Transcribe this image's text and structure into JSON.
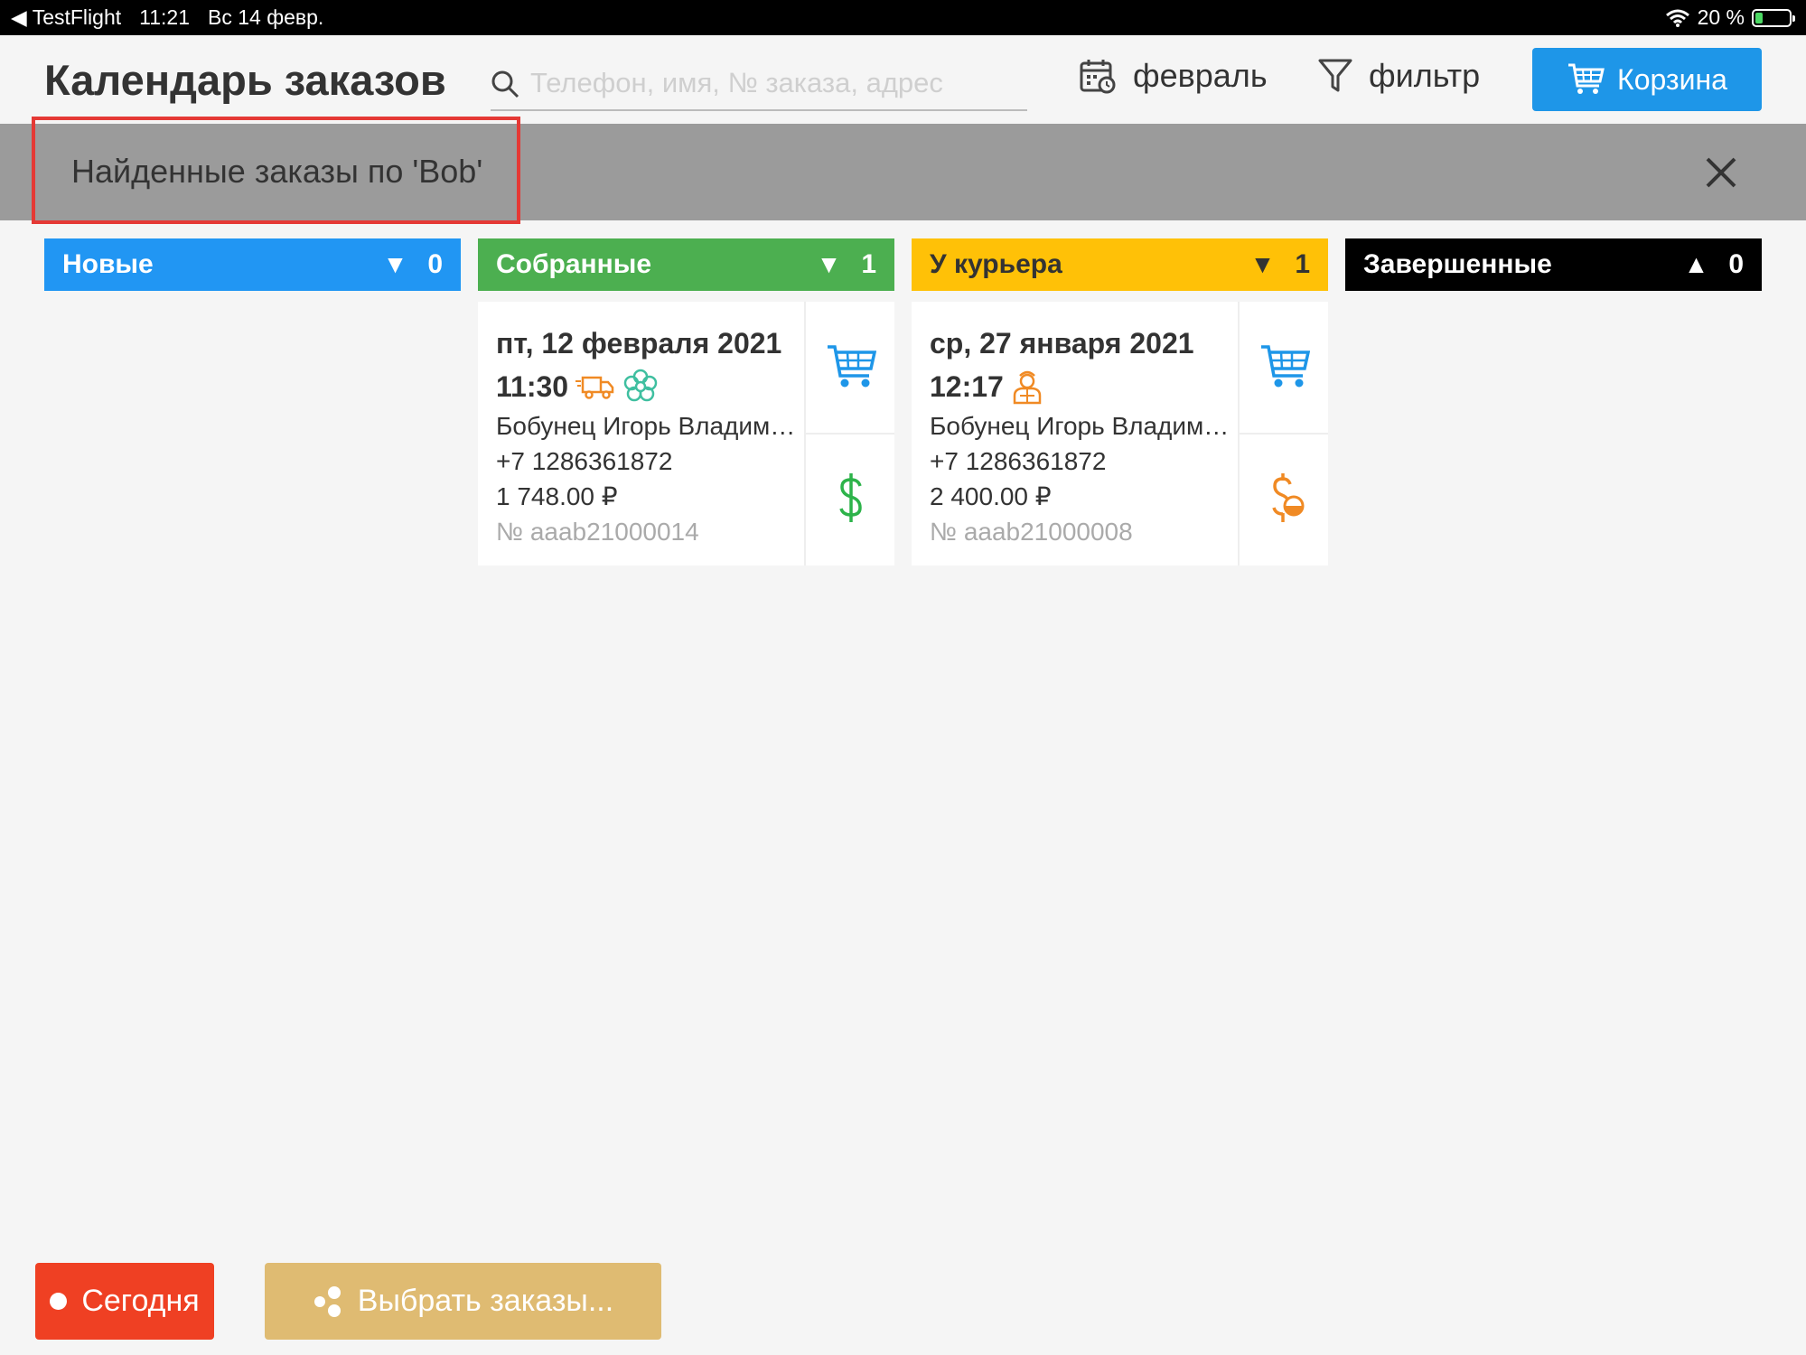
{
  "status_bar": {
    "back_app": "TestFlight",
    "time": "11:21",
    "date": "Вс 14 февр.",
    "battery": "20 %",
    "battery_level": 0.2
  },
  "header": {
    "title": "Календарь заказов",
    "search_placeholder": "Телефон, имя, № заказа, адрес",
    "month_label": "февраль",
    "filter_label": "фильтр",
    "cart_label": "Корзина"
  },
  "banner": {
    "text": "Найденные заказы по 'Bob'"
  },
  "columns": [
    {
      "name": "Новые",
      "arrow": "▼",
      "count": "0",
      "color": "#2196f3"
    },
    {
      "name": "Собранные",
      "arrow": "▼",
      "count": "1",
      "color": "#4caf50",
      "order": {
        "date": "пт, 12 февраля 2021",
        "time": "11:30",
        "customer": "Бобунец Игорь Владимирович",
        "phone": "+7 1286361872",
        "amount": "1 748.00 ₽",
        "number": "№ aaab21000014",
        "payment_icon": "dollar-icon",
        "payment_color": "#2db34a"
      }
    },
    {
      "name": "У курьера",
      "arrow": "▼",
      "count": "1",
      "color": "#ffc107",
      "order": {
        "date": "ср, 27 января 2021",
        "time": "12:17",
        "customer": "Бобунец Игорь Владимирович",
        "phone": "+7 1286361872",
        "amount": "2 400.00 ₽",
        "number": "№ aaab21000008",
        "payment_icon": "partial-payment-icon",
        "payment_color": "#f08a24"
      }
    },
    {
      "name": "Завершенные",
      "arrow": "▲",
      "count": "0",
      "color": "#000000"
    }
  ],
  "footer": {
    "today_label": "Сегодня",
    "select_label": "Выбрать заказы..."
  }
}
